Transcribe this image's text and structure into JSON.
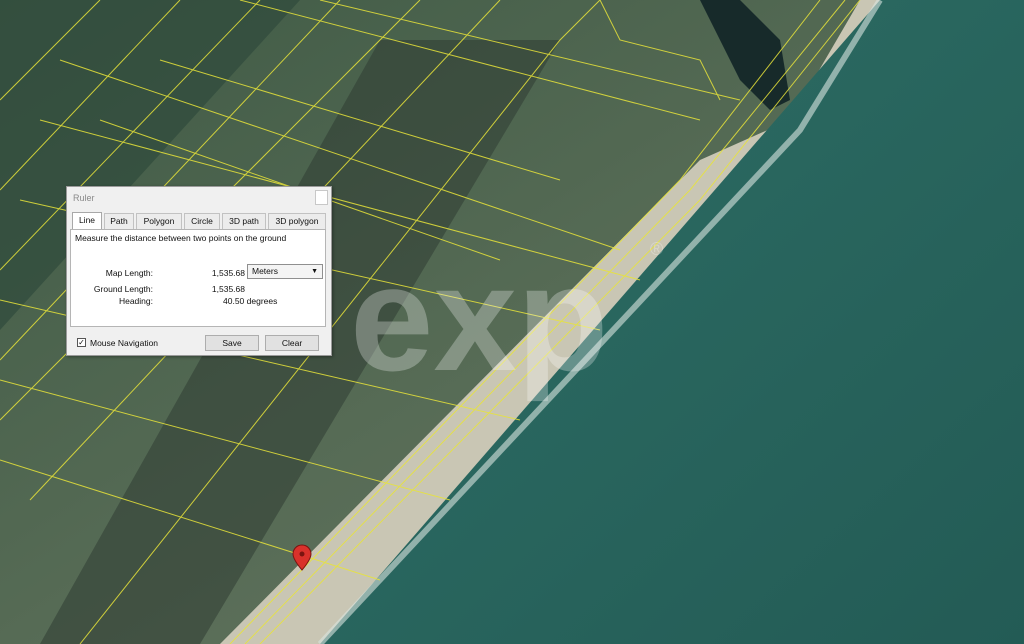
{
  "map": {
    "watermark": "exp",
    "watermark_symbol": "®",
    "pin_color": "#d9312b",
    "parcel_line_color": "#e8e43a",
    "ocean_color": "#2a6a62"
  },
  "ruler": {
    "title": "Ruler",
    "tabs": [
      {
        "label": "Line",
        "active": true
      },
      {
        "label": "Path",
        "active": false
      },
      {
        "label": "Polygon",
        "active": false
      },
      {
        "label": "Circle",
        "active": false
      },
      {
        "label": "3D path",
        "active": false
      },
      {
        "label": "3D polygon",
        "active": false
      }
    ],
    "description": "Measure the distance between two points on the ground",
    "map_length_label": "Map Length:",
    "map_length_value": "1,535.68",
    "units_selected": "Meters",
    "ground_length_label": "Ground Length:",
    "ground_length_value": "1,535.68",
    "heading_label": "Heading:",
    "heading_value": "40.50 degrees",
    "mouse_navigation_label": "Mouse Navigation",
    "mouse_navigation_checked": true,
    "save_label": "Save",
    "clear_label": "Clear"
  }
}
